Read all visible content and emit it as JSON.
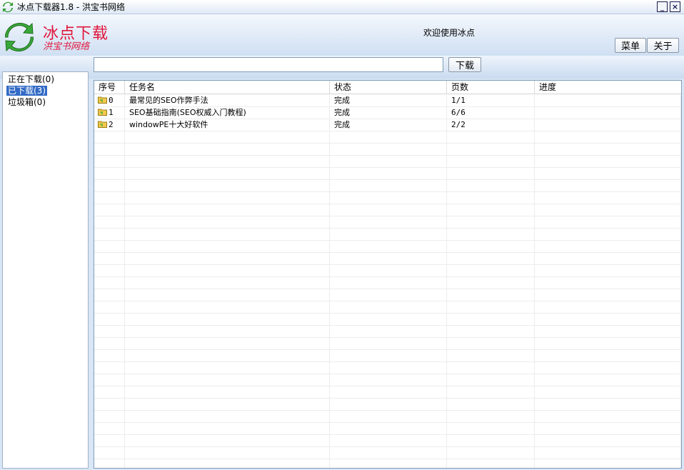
{
  "window": {
    "title": "冰点下载器1.8 - 洪宝书网络",
    "minimize_label": "_",
    "close_label": "×"
  },
  "header": {
    "brand_name": "冰点下载",
    "brand_sub": "洪宝书网络",
    "welcome": "欢迎使用冰点",
    "menu_label": "菜单",
    "about_label": "关于"
  },
  "toolbar": {
    "url_value": "",
    "url_placeholder": "",
    "download_label": "下载"
  },
  "sidebar": {
    "items": [
      {
        "label": "正在下载(0)",
        "selected": false
      },
      {
        "label": "已下载(3)",
        "selected": true
      },
      {
        "label": "垃圾箱(0)",
        "selected": false
      }
    ]
  },
  "task_list": {
    "columns": [
      "序号",
      "任务名",
      "状态",
      "页数",
      "进度"
    ],
    "rows": [
      {
        "index": "0",
        "name": "最常见的SEO作弊手法",
        "status": "完成",
        "pages": "1/1",
        "progress": ""
      },
      {
        "index": "1",
        "name": "SEO基础指南(SEO权威入门教程)",
        "status": "完成",
        "pages": "6/6",
        "progress": ""
      },
      {
        "index": "2",
        "name": "windowPE十大好软件",
        "status": "完成",
        "pages": "2/2",
        "progress": ""
      }
    ]
  },
  "colors": {
    "brand_red": "#e0163c",
    "selection_blue": "#316ac5",
    "folder_yellow": "#f2c94c"
  }
}
